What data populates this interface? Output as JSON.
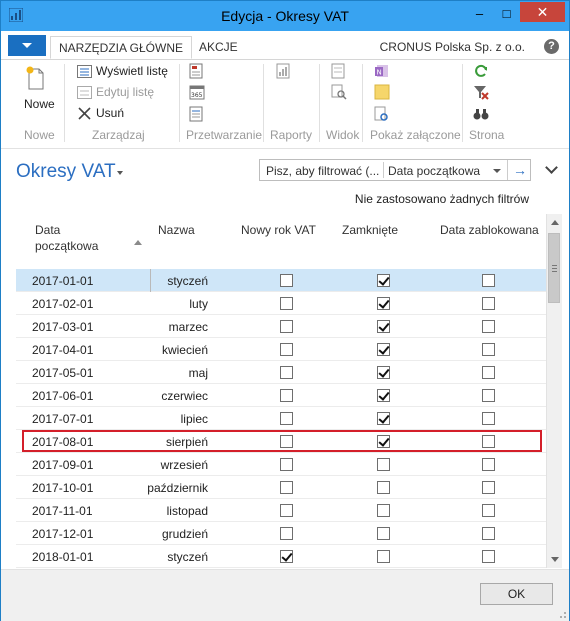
{
  "window": {
    "title": "Edycja - Okresy VAT",
    "minimize_glyph": "–",
    "maximize_glyph": "□",
    "close_glyph": "✕"
  },
  "ribbon_tabs": {
    "home": "NARZĘDZIA GŁÓWNE",
    "actions": "AKCJE",
    "company": "CRONUS Polska Sp. z o.o.",
    "help": "?"
  },
  "ribbon": {
    "new_label": "Nowe",
    "show_list": "Wyświetl listę",
    "edit_list": "Edytuj listę",
    "delete": "Usuń",
    "groups": {
      "new": "Nowe",
      "manage": "Zarządzaj",
      "process": "Przetwarzanie",
      "reports": "Raporty",
      "view": "Widok",
      "attachments": "Pokaż załączone",
      "page": "Strona"
    }
  },
  "page": {
    "title": "Okresy VAT",
    "filter_placeholder": "Pisz, aby filtrować (...",
    "filter_field": "Data początkowa",
    "filter_go": "→",
    "no_filters": "Nie zastosowano żadnych filtrów"
  },
  "table": {
    "columns": {
      "start_date_line1": "Data",
      "start_date_line2": "początkowa",
      "name": "Nazwa",
      "new_year": "Nowy rok VAT",
      "closed": "Zamknięte",
      "date_locked": "Data zablokowana"
    },
    "rows": [
      {
        "date": "2017-01-01",
        "name": "styczeń",
        "new_year": false,
        "closed": true,
        "locked": false,
        "selected": true
      },
      {
        "date": "2017-02-01",
        "name": "luty",
        "new_year": false,
        "closed": true,
        "locked": false
      },
      {
        "date": "2017-03-01",
        "name": "marzec",
        "new_year": false,
        "closed": true,
        "locked": false
      },
      {
        "date": "2017-04-01",
        "name": "kwiecień",
        "new_year": false,
        "closed": true,
        "locked": false
      },
      {
        "date": "2017-05-01",
        "name": "maj",
        "new_year": false,
        "closed": true,
        "locked": false
      },
      {
        "date": "2017-06-01",
        "name": "czerwiec",
        "new_year": false,
        "closed": true,
        "locked": false
      },
      {
        "date": "2017-07-01",
        "name": "lipiec",
        "new_year": false,
        "closed": true,
        "locked": false
      },
      {
        "date": "2017-08-01",
        "name": "sierpień",
        "new_year": false,
        "closed": true,
        "locked": false,
        "highlighted": true
      },
      {
        "date": "2017-09-01",
        "name": "wrzesień",
        "new_year": false,
        "closed": false,
        "locked": false
      },
      {
        "date": "2017-10-01",
        "name": "październik",
        "new_year": false,
        "closed": false,
        "locked": false
      },
      {
        "date": "2017-11-01",
        "name": "listopad",
        "new_year": false,
        "closed": false,
        "locked": false
      },
      {
        "date": "2017-12-01",
        "name": "grudzień",
        "new_year": false,
        "closed": false,
        "locked": false
      },
      {
        "date": "2018-01-01",
        "name": "styczeń",
        "new_year": true,
        "closed": false,
        "locked": false
      }
    ]
  },
  "footer": {
    "ok": "OK"
  },
  "colors": {
    "accent": "#38a3f1",
    "title_blue": "#2b6ec1",
    "highlight_red": "#d41f2a",
    "selected_row": "#cfe6f8"
  }
}
